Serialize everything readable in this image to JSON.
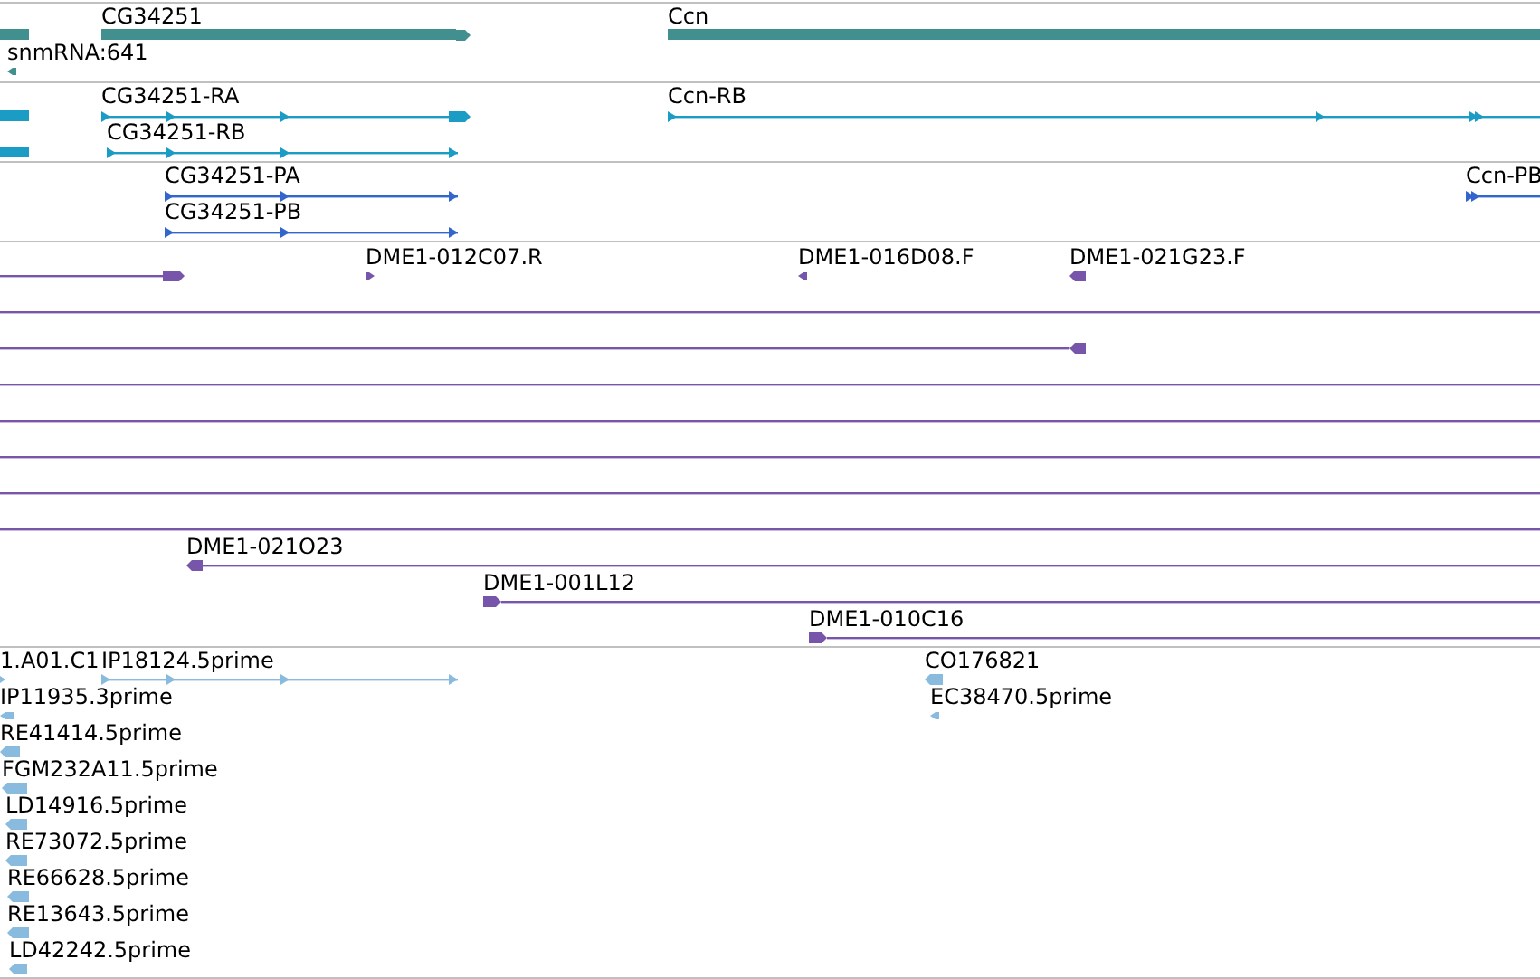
{
  "tracks": [
    {
      "color": "#418f8f",
      "features": [
        {
          "kind": "bar"
        },
        {
          "kind": "bar",
          "label": "CG34251",
          "reverse": false
        },
        {
          "kind": "bar",
          "label": "Ccn"
        },
        {
          "label": "snmRNA:641",
          "reverse": true
        }
      ]
    },
    {
      "color": "#1a9cc4",
      "features": [
        {
          "kind": "bar"
        },
        {
          "kind": "line",
          "label": "CG34251-RA",
          "reverse": false
        },
        {
          "kind": "line",
          "label": "CG34251-RB",
          "reverse": false
        },
        {
          "kind": "bar"
        },
        {
          "kind": "line",
          "label": "Ccn-RB",
          "reverse": false
        }
      ]
    },
    {
      "color": "#3366cc",
      "features": [
        {
          "kind": "line",
          "label": "CG34251-PA",
          "reverse": false
        },
        {
          "kind": "line",
          "label": "CG34251-PB",
          "reverse": false
        },
        {
          "kind": "line",
          "label": "Ccn-PB",
          "reverse": false
        }
      ]
    },
    {
      "color": "#7755aa",
      "features": [
        {
          "kind": "line",
          "reverse": false
        },
        {
          "label": "DME1-012C07.R",
          "reverse": false
        },
        {
          "label": "DME1-016D08.F",
          "reverse": true
        },
        {
          "label": "DME1-021G23.F",
          "reverse": true
        },
        {
          "kind": "line"
        },
        {
          "kind": "line",
          "reverse": true
        },
        {
          "kind": "line"
        },
        {
          "kind": "line"
        },
        {
          "kind": "line"
        },
        {
          "kind": "line"
        },
        {
          "kind": "line"
        },
        {
          "kind": "line",
          "label": "DME1-021O23",
          "reverse": true
        },
        {
          "kind": "line",
          "label": "DME1-001L12",
          "reverse": false
        },
        {
          "kind": "line",
          "label": "DME1-010C16",
          "reverse": false
        }
      ]
    },
    {
      "color": "#88bbdd",
      "features": [
        {
          "label": "1.A01.C1",
          "reverse": false
        },
        {
          "kind": "line",
          "label": "IP18124.5prime",
          "reverse": false
        },
        {
          "label": "CO176821",
          "reverse": true
        },
        {
          "label": "IP11935.3prime",
          "reverse": true
        },
        {
          "label": "EC38470.5prime",
          "reverse": true
        },
        {
          "label": "RE41414.5prime",
          "reverse": true
        },
        {
          "label": "FGM232A11.5prime",
          "reverse": true
        },
        {
          "label": "LD14916.5prime",
          "reverse": true
        },
        {
          "label": "RE73072.5prime",
          "reverse": true
        },
        {
          "label": "RE66628.5prime",
          "reverse": true
        },
        {
          "label": "RE13643.5prime",
          "reverse": true
        },
        {
          "label": "LD42242.5prime",
          "reverse": true
        }
      ]
    }
  ]
}
